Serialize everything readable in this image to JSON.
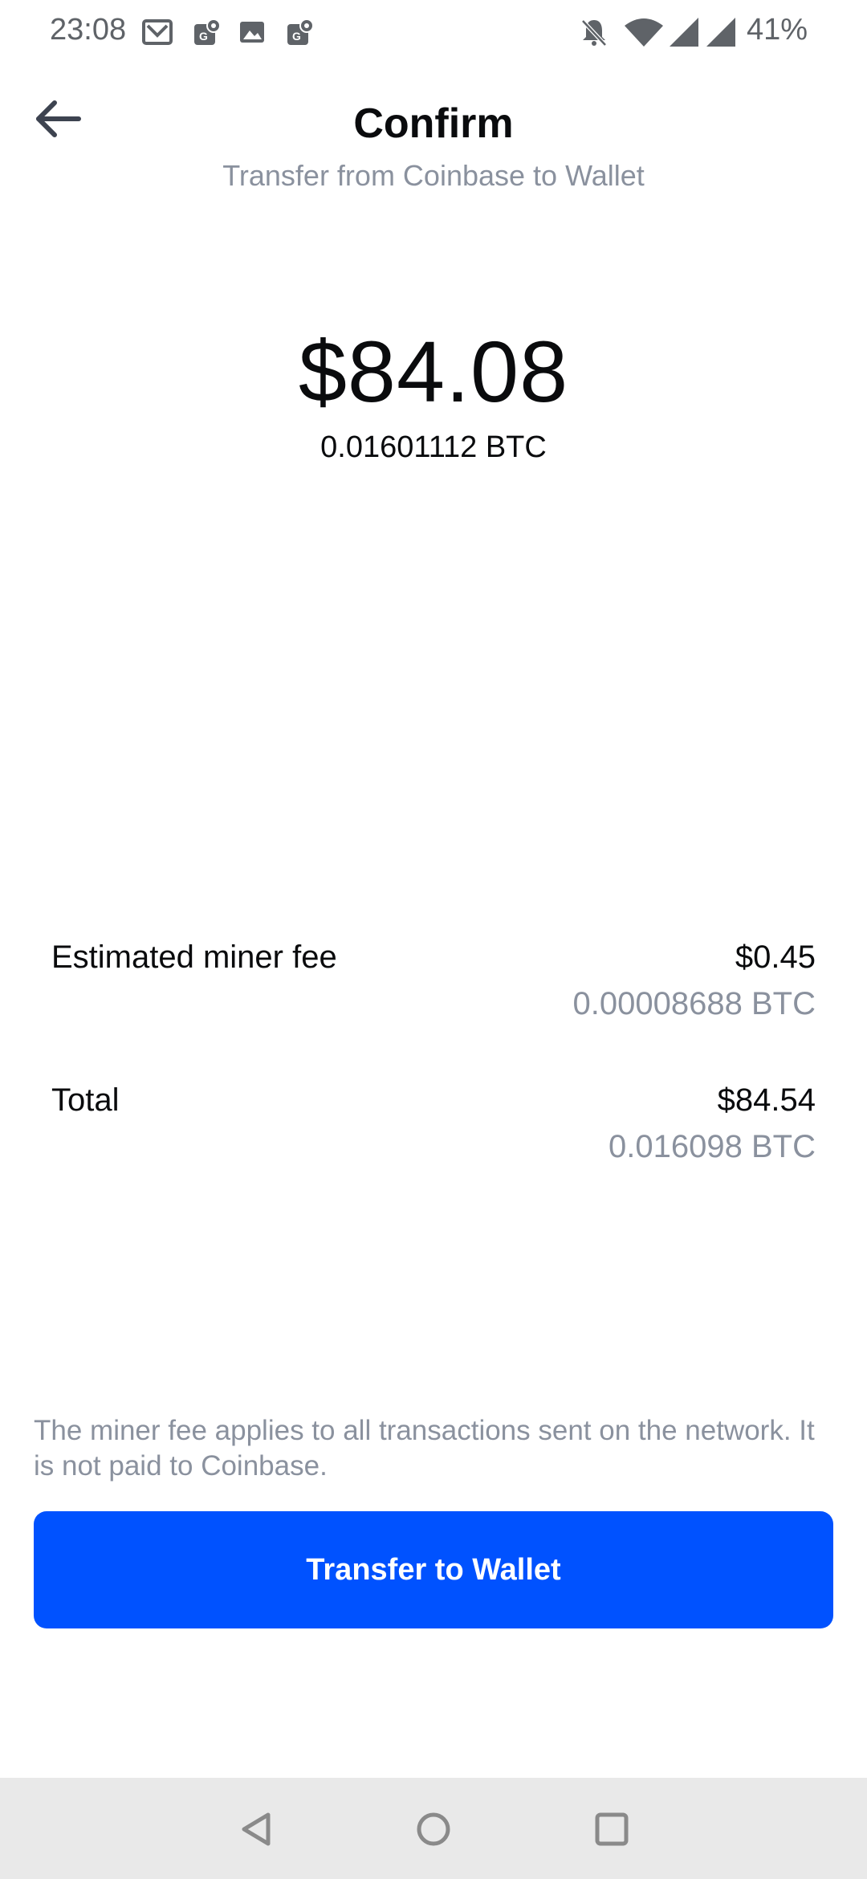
{
  "status_bar": {
    "time": "23:08",
    "battery": "41%",
    "notification_icons": [
      "gmail-icon",
      "maps-icon",
      "gallery-icon",
      "maps-icon"
    ],
    "system_icons": [
      "bell-muted-icon",
      "wifi-icon",
      "signal-icon",
      "signal-icon"
    ]
  },
  "header": {
    "title": "Confirm",
    "subtitle": "Transfer from Coinbase to Wallet"
  },
  "amount": {
    "fiat": "$84.08",
    "crypto": "0.01601112 BTC"
  },
  "fees": {
    "miner_fee_label": "Estimated miner fee",
    "miner_fee_fiat": "$0.45",
    "miner_fee_crypto": "0.00008688 BTC",
    "total_label": "Total",
    "total_fiat": "$84.54",
    "total_crypto": "0.016098 BTC"
  },
  "disclaimer": "The miner fee applies to all transactions sent on the network. It is not paid to Coinbase.",
  "cta": {
    "label": "Transfer to Wallet"
  },
  "colors": {
    "accent": "#0052ff",
    "text_primary": "#0a0b0d",
    "text_secondary": "#8a919e",
    "nav_bar": "#e9e9e9"
  }
}
